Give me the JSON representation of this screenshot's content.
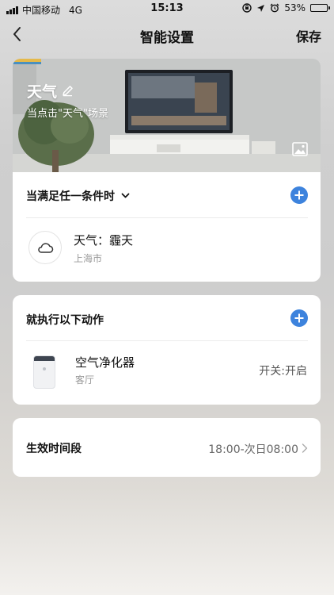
{
  "status_bar": {
    "carrier": "中国移动",
    "network": "4G",
    "time": "15:13",
    "battery": "53%",
    "battery_level": 0.53
  },
  "nav": {
    "title": "智能设置",
    "save": "保存"
  },
  "scene": {
    "title": "天气",
    "subtitle": "当点击\"天气\"场景"
  },
  "conditions": {
    "header": "当满足任一条件时",
    "items": [
      {
        "name": "天气：霾天",
        "sub": "上海市",
        "icon": "cloud-icon"
      }
    ]
  },
  "actions": {
    "header": "就执行以下动作",
    "items": [
      {
        "name": "空气净化器",
        "sub": "客厅",
        "state": "开关:开启",
        "icon": "air-purifier-icon"
      }
    ]
  },
  "effective": {
    "label": "生效时间段",
    "value": "18:00-次日08:00"
  },
  "colors": {
    "accent": "#3d83dd"
  }
}
